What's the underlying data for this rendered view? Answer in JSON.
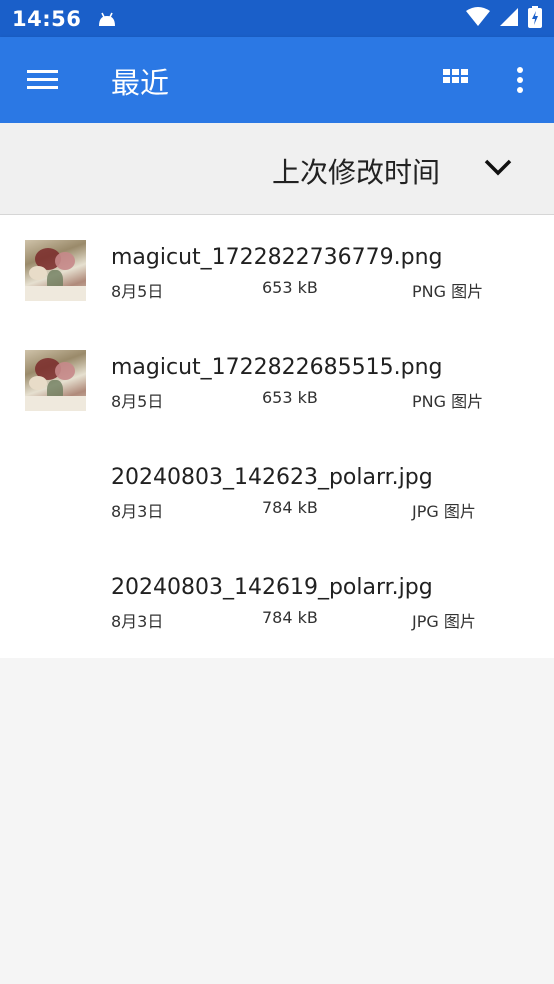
{
  "status_bar": {
    "time": "14:56",
    "icons": [
      "android-icon",
      "wifi-icon",
      "signal-icon",
      "battery-charging-icon"
    ]
  },
  "app_bar": {
    "title": "最近",
    "icons": [
      "menu-icon",
      "grid-view-icon",
      "more-vert-icon"
    ]
  },
  "sort": {
    "label": "上次修改时间",
    "icon": "chevron-down-icon"
  },
  "files": [
    {
      "name": "magicut_1722822736779.png",
      "date": "8月5日",
      "size": "653 kB",
      "type": "PNG 图片",
      "has_thumbnail": true
    },
    {
      "name": "magicut_1722822685515.png",
      "date": "8月5日",
      "size": "653 kB",
      "type": "PNG 图片",
      "has_thumbnail": true
    },
    {
      "name": "20240803_142623_polarr.jpg",
      "date": "8月3日",
      "size": "784 kB",
      "type": "JPG 图片",
      "has_thumbnail": false
    },
    {
      "name": "20240803_142619_polarr.jpg",
      "date": "8月3日",
      "size": "784 kB",
      "type": "JPG 图片",
      "has_thumbnail": false
    }
  ],
  "colors": {
    "status_bar": "#1a5fc9",
    "app_bar": "#2b78e4",
    "sort_bar": "#f0f0f0",
    "list_background": "#ffffff",
    "page_background": "#f5f5f5"
  }
}
